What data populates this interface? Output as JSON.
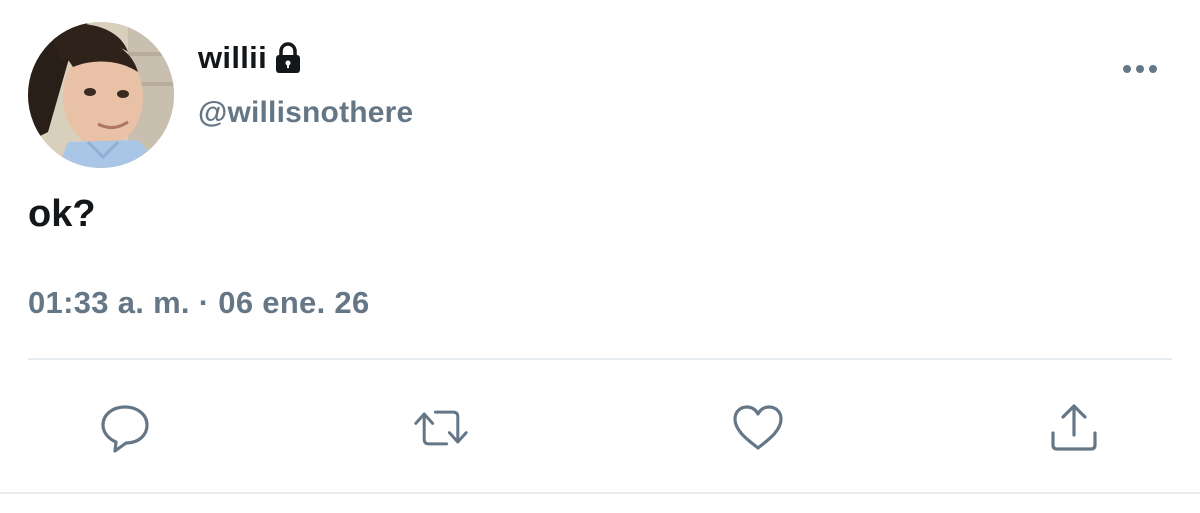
{
  "tweet": {
    "display_name": "willii",
    "handle": "@willisnothere",
    "text": "ok?",
    "timestamp": "01:33 a. m. · 06 ene. 26",
    "protected_icon": "lock-icon"
  },
  "actions": {
    "reply_icon": "speech-bubble-icon",
    "retweet_icon": "retweet-icon",
    "like_icon": "heart-icon",
    "share_icon": "share-upload-icon",
    "more_icon": "more-dots-icon"
  },
  "colors": {
    "primary_text": "#14171a",
    "secondary_text": "#657786",
    "divider": "#e6ecf0",
    "background": "#ffffff"
  }
}
